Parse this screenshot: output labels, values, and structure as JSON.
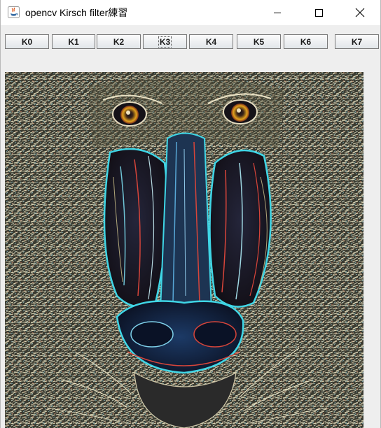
{
  "window": {
    "title": "opencv Kirsch filter練習",
    "controls": [
      "minimize",
      "maximize",
      "close"
    ]
  },
  "toolbar": {
    "buttons": [
      {
        "label": "K0"
      },
      {
        "label": "K1"
      },
      {
        "label": "K2"
      },
      {
        "label": "K3",
        "focused": true
      },
      {
        "label": "K4"
      },
      {
        "label": "K5"
      },
      {
        "label": "K6"
      },
      {
        "label": "K7"
      }
    ]
  },
  "image": {
    "subject": "mandrill",
    "filter": "Kirsch edge detection",
    "colors": {
      "background": "#0d1016",
      "fur": "#c9c6a8",
      "edge_cyan": "#3fd6e6",
      "edge_red": "#d8453a",
      "eye_yellow": "#e2a21c",
      "nose_blue": "#2c5c9a"
    }
  }
}
